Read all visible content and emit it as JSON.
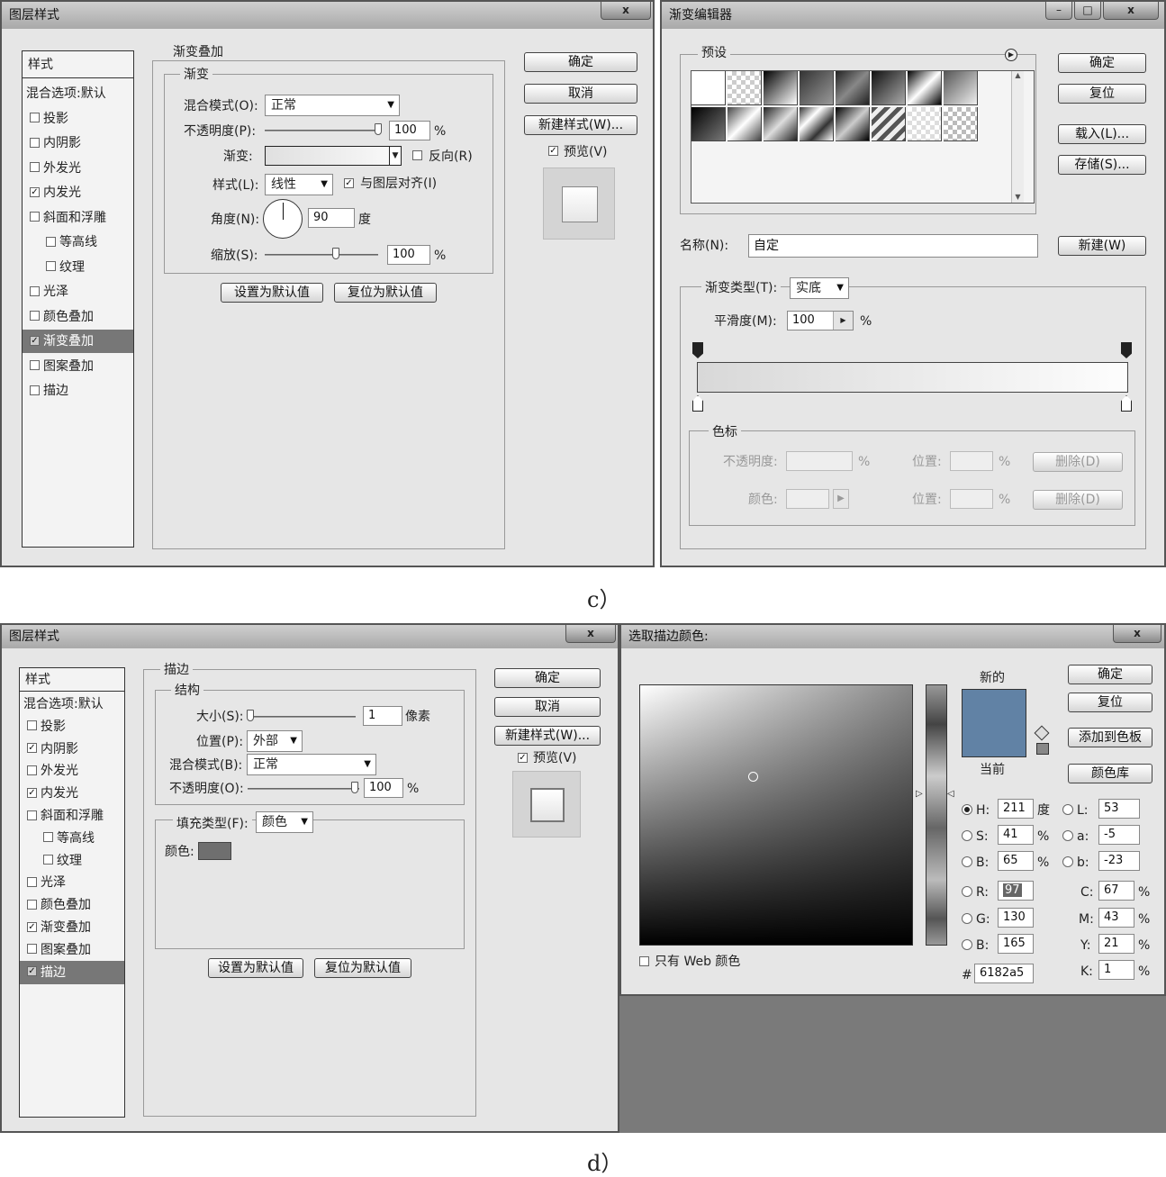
{
  "panel_c": {
    "layer_style": {
      "title": "图层样式",
      "close": "x",
      "styles_header": "样式",
      "items": [
        {
          "label": "混合选项:默认",
          "checked": null
        },
        {
          "label": "投影",
          "checked": false
        },
        {
          "label": "内阴影",
          "checked": false
        },
        {
          "label": "外发光",
          "checked": false
        },
        {
          "label": "内发光",
          "checked": true
        },
        {
          "label": "斜面和浮雕",
          "checked": false
        },
        {
          "label": "等高线",
          "checked": false
        },
        {
          "label": "纹理",
          "checked": false
        },
        {
          "label": "光泽",
          "checked": false
        },
        {
          "label": "颜色叠加",
          "checked": false
        },
        {
          "label": "渐变叠加",
          "checked": true,
          "selected": true
        },
        {
          "label": "图案叠加",
          "checked": false
        },
        {
          "label": "描边",
          "checked": false
        }
      ],
      "section_title": "渐变叠加",
      "group_title": "渐变",
      "blend_mode_label": "混合模式(O):",
      "blend_mode_value": "正常",
      "opacity_label": "不透明度(P):",
      "opacity_value": "100",
      "percent": "%",
      "gradient_label": "渐变:",
      "reverse_label": "反向(R)",
      "style_label": "样式(L):",
      "style_value": "线性",
      "align_label": "与图层对齐(I)",
      "angle_label": "角度(N):",
      "angle_value": "90",
      "angle_unit": "度",
      "scale_label": "缩放(S):",
      "scale_value": "100",
      "set_default": "设置为默认值",
      "reset_default": "复位为默认值",
      "ok": "确定",
      "cancel": "取消",
      "new_style": "新建样式(W)...",
      "preview": "预览(V)"
    },
    "gradient_editor": {
      "title": "渐变编辑器",
      "min": "–",
      "max": "□",
      "close": "x",
      "presets_label": "预设",
      "ok": "确定",
      "reset": "复位",
      "load": "载入(L)...",
      "save": "存储(S)...",
      "name_label": "名称(N):",
      "name_value": "自定",
      "new": "新建(W)",
      "type_label": "渐变类型(T):",
      "type_value": "实底",
      "smooth_label": "平滑度(M):",
      "smooth_value": "100",
      "percent": "%",
      "stops_group": "色标",
      "stop_opacity_label": "不透明度:",
      "location_label": "位置:",
      "delete": "删除(D)",
      "stop_color_label": "颜色:"
    },
    "caption": "c）"
  },
  "panel_d": {
    "layer_style": {
      "title": "图层样式",
      "close": "x",
      "styles_header": "样式",
      "items": [
        {
          "label": "混合选项:默认",
          "checked": null
        },
        {
          "label": "投影",
          "checked": false
        },
        {
          "label": "内阴影",
          "checked": true
        },
        {
          "label": "外发光",
          "checked": false
        },
        {
          "label": "内发光",
          "checked": true
        },
        {
          "label": "斜面和浮雕",
          "checked": false
        },
        {
          "label": "等高线",
          "checked": false
        },
        {
          "label": "纹理",
          "checked": false
        },
        {
          "label": "光泽",
          "checked": false
        },
        {
          "label": "颜色叠加",
          "checked": false
        },
        {
          "label": "渐变叠加",
          "checked": true
        },
        {
          "label": "图案叠加",
          "checked": false
        },
        {
          "label": "描边",
          "checked": true,
          "selected": true
        }
      ],
      "section_title": "描边",
      "group_title": "结构",
      "size_label": "大小(S):",
      "size_value": "1",
      "size_unit": "像素",
      "position_label": "位置(P):",
      "position_value": "外部",
      "blend_mode_label": "混合模式(B):",
      "blend_mode_value": "正常",
      "opacity_label": "不透明度(O):",
      "opacity_value": "100",
      "percent": "%",
      "fill_type_label": "填充类型(F):",
      "fill_type_value": "颜色",
      "color_label": "颜色:",
      "set_default": "设置为默认值",
      "reset_default": "复位为默认值",
      "ok": "确定",
      "cancel": "取消",
      "new_style": "新建样式(W)...",
      "preview": "预览(V)"
    },
    "color_picker": {
      "title": "选取描边颜色:",
      "close": "x",
      "new_label": "新的",
      "current_label": "当前",
      "ok": "确定",
      "reset": "复位",
      "add_swatch": "添加到色板",
      "color_libraries": "颜色库",
      "web_only": "只有 Web 颜色",
      "fields": {
        "H": {
          "label": "H:",
          "value": "211",
          "unit": "度"
        },
        "S": {
          "label": "S:",
          "value": "41",
          "unit": "%"
        },
        "Bv": {
          "label": "B:",
          "value": "65",
          "unit": "%"
        },
        "R": {
          "label": "R:",
          "value": "97"
        },
        "G": {
          "label": "G:",
          "value": "130"
        },
        "Bb": {
          "label": "B:",
          "value": "165"
        },
        "L": {
          "label": "L:",
          "value": "53"
        },
        "a": {
          "label": "a:",
          "value": "-5"
        },
        "b": {
          "label": "b:",
          "value": "-23"
        },
        "C": {
          "label": "C:",
          "value": "67",
          "unit": "%"
        },
        "M": {
          "label": "M:",
          "value": "43",
          "unit": "%"
        },
        "Y": {
          "label": "Y:",
          "value": "21",
          "unit": "%"
        },
        "K": {
          "label": "K:",
          "value": "1",
          "unit": "%"
        }
      },
      "hash": "#",
      "hex_value": "6182a5",
      "color_hex": "#6182a5"
    },
    "caption": "d）"
  }
}
